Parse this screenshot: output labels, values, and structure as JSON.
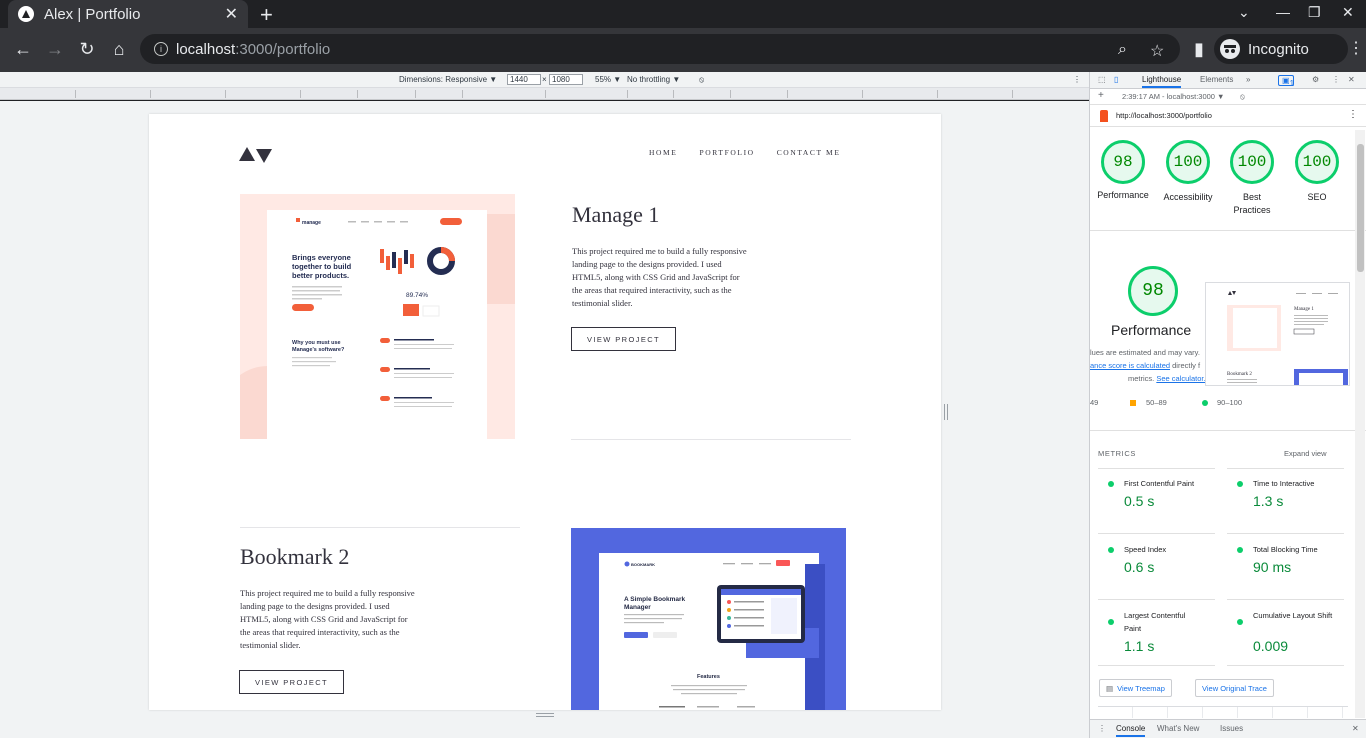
{
  "browser": {
    "tab_title": "Alex | Portfolio",
    "url_host": "localhost",
    "url_path": ":3000/portfolio",
    "profile_label": "Incognito"
  },
  "device_toolbar": {
    "dimensions_label": "Dimensions: Responsive ▼",
    "width": "1440",
    "times": "×",
    "height": "1080",
    "zoom": "55% ▼",
    "throttling": "No throttling ▼"
  },
  "site": {
    "nav": [
      "HOME",
      "PORTFOLIO",
      "CONTACT ME"
    ],
    "projects": [
      {
        "title": "Manage 1",
        "description": "This project required me to build a fully responsive landing page to the designs provided. I used HTML5, along with CSS Grid and JavaScript for the areas that required interactivity, such as the testimonial slider.",
        "button": "VIEW PROJECT"
      },
      {
        "title": "Bookmark 2",
        "description": "This project required me to build a fully responsive landing page to the designs provided. I used HTML5, along with CSS Grid and JavaScript for the areas that required interactivity, such as the testimonial slider.",
        "button": "VIEW PROJECT"
      }
    ],
    "manage_mock": {
      "brand": "manage",
      "headline": "Brings everyone together to build better products.",
      "stat": "89.74%",
      "subhead": "Why you must use Manage's software?"
    },
    "bookmark_mock": {
      "brand": "BOOKMARK",
      "headline": "A Simple Bookmark Manager",
      "features": "Features"
    }
  },
  "devtools": {
    "tabs": [
      "Lighthouse",
      "Elements"
    ],
    "issues_count": "1",
    "report_time": "2:39:17 AM - localhost:3000 ▼",
    "report_url": "http://localhost:3000/portfolio",
    "scores": [
      {
        "label": "Performance",
        "value": "98"
      },
      {
        "label": "Accessibility",
        "value": "100"
      },
      {
        "label": "Best Practices",
        "value": "100"
      },
      {
        "label": "SEO",
        "value": "100"
      }
    ],
    "perf_score": "98",
    "perf_label": "Performance",
    "note_line1": "lues are estimated and may vary.",
    "note_link1": "ance score is calculated",
    "note_line2": " directly f",
    "note_line3": "metrics.",
    "note_link2": "See calculator.",
    "legend": [
      "49",
      "50–89",
      "90–100"
    ],
    "metrics_header": "METRICS",
    "expand_view": "Expand view",
    "metrics": [
      {
        "name": "First Contentful Paint",
        "value": "0.5 s"
      },
      {
        "name": "Time to Interactive",
        "value": "1.3 s"
      },
      {
        "name": "Speed Index",
        "value": "0.6 s"
      },
      {
        "name": "Total Blocking Time",
        "value": "90 ms"
      },
      {
        "name": "Largest Contentful Paint",
        "value": "1.1 s"
      },
      {
        "name": "Cumulative Layout Shift",
        "value": "0.009"
      }
    ],
    "view_treemap": "View Treemap",
    "view_trace": "View Original Trace",
    "drawer_tabs": [
      "Console",
      "What's New",
      "Issues"
    ],
    "colors": {
      "pass": "#0cce6b",
      "average": "#ffa400"
    }
  }
}
